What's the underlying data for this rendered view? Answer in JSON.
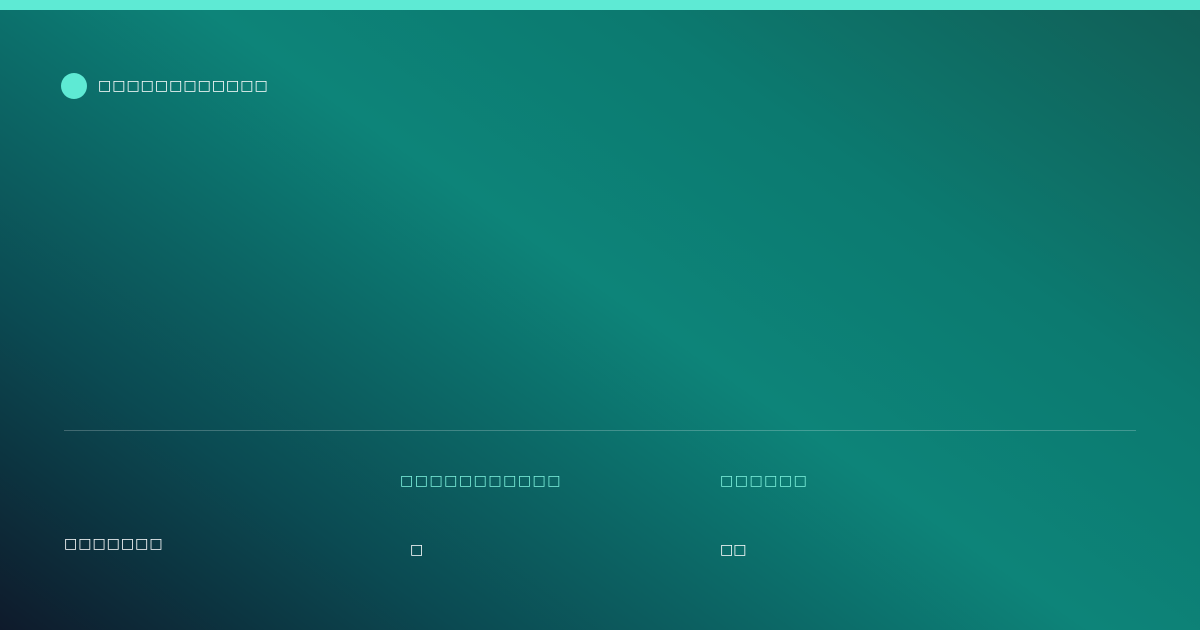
{
  "brand": {
    "name": "□□□□□□□□□□□□",
    "accent_color": "#5eead4"
  },
  "footer": {
    "left_text": "□□□□□□□"
  },
  "stats": [
    {
      "label": "□□□□□□□□□□□",
      "value": "□"
    },
    {
      "label": "□□□□□□",
      "value": "□□"
    }
  ],
  "colors": {
    "accent": "#5eead4",
    "label": "#7ff3de",
    "text": "#ffffff"
  }
}
